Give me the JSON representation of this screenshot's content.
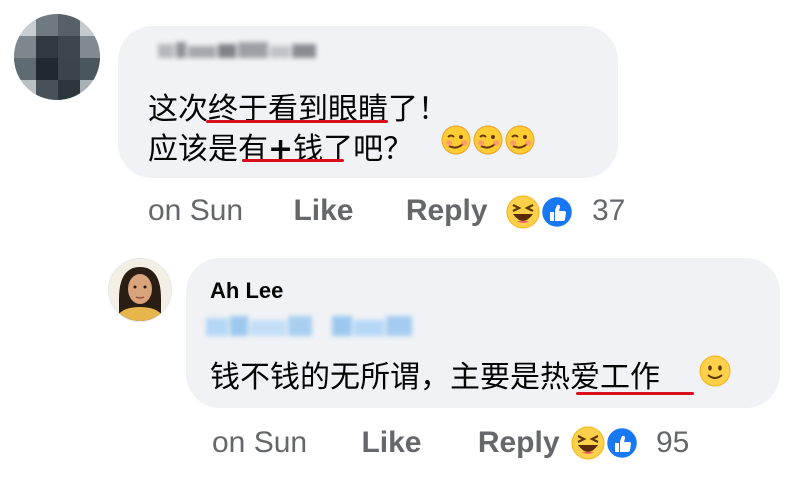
{
  "comment1": {
    "line1": "这次终于看到眼睛了！",
    "line2_prefix": "应该是",
    "line2_you": "有",
    "line2_plus": "+",
    "line2_qian": "钱",
    "line2_suffix": "了吧？",
    "emojis": [
      "woozy-face",
      "woozy-face",
      "woozy-face"
    ],
    "time": "on Sun",
    "like_label": "Like",
    "reply_label": "Reply",
    "reaction_count": "37",
    "reactions": [
      "laughing-emoji",
      "like-thumb"
    ]
  },
  "comment2": {
    "author": "Ah Lee",
    "text_main": "钱不钱的无所谓，主要是",
    "text_underlined": "热爱工作",
    "emoji": "slightly-smiling-face",
    "time": "on Sun",
    "like_label": "Like",
    "reply_label": "Reply",
    "reaction_count": "95",
    "reactions": [
      "laughing-emoji",
      "like-thumb"
    ]
  },
  "colors": {
    "bubble": "#f0f2f5",
    "underline": "#d90f1b",
    "meta_text": "#65676b",
    "like_blue": "#1877f2"
  }
}
